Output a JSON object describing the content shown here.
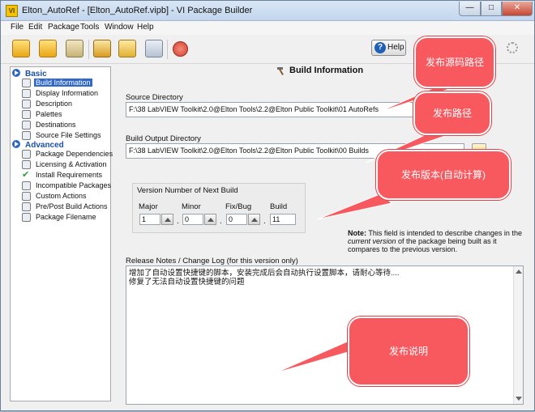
{
  "window": {
    "app_icon": "VI",
    "title": "Elton_AutoRef - [Elton_AutoRef.vipb] - VI Package Builder",
    "minimize": "—",
    "maximize": "□",
    "close": "✕"
  },
  "menu": [
    "File",
    "Edit",
    "Package",
    "Tools",
    "Window",
    "Help"
  ],
  "toolbar": {
    "buttons": [
      "new-package-icon",
      "open-package-icon",
      "save-package-icon",
      "build-icon",
      "test-icon",
      "publish-icon",
      "stop-icon"
    ],
    "help_label": "Help",
    "help_symbol": "?"
  },
  "sidebar": {
    "basic_heading": "Basic",
    "basic_items": [
      "Build Information",
      "Display Information",
      "Description",
      "Palettes",
      "Destinations",
      "Source File Settings"
    ],
    "advanced_heading": "Advanced",
    "advanced_items": [
      "Package Dependencies",
      "Licensing & Activation",
      "Install Requirements",
      "Incompatible Packages",
      "Custom Actions",
      "Pre/Post Build Actions",
      "Package Filename"
    ],
    "selected": "Build Information"
  },
  "build_info": {
    "title": "Build Information",
    "source_label": "Source Directory",
    "source_value": "F:\\38 LabVIEW Toolkit\\2.0@Elton Tools\\2.2@Elton Public Toolkit\\01 AutoRefs",
    "output_label": "Build Output Directory",
    "output_value": "F:\\38 LabVIEW Toolkit\\2.0@Elton Tools\\2.2@Elton Public Toolkit\\00 Builds",
    "version_title": "Version Number of Next Build",
    "version": {
      "major_label": "Major",
      "major": "1",
      "minor_label": "Minor",
      "minor": "0",
      "fix_label": "Fix/Bug",
      "fix": "0",
      "build_label": "Build",
      "build": "11",
      "separator": "."
    },
    "note_bold": "Note:",
    "note_1": " This field is intended to describe changes in the",
    "note_italic": "current version",
    "note_2": " of the package being built as it compares to the previous version.",
    "notes_label": "Release Notes / Change Log (for this version only)",
    "notes_lines": [
      "增加了自动设置快捷键的脚本，安装完成后会自动执行设置脚本，请耐心等待....",
      "修复了无法自动设置快捷键的问题"
    ]
  },
  "callouts": {
    "source": "发布源码路径",
    "output": "发布路径",
    "version": "发布版本(自动计算)",
    "notes": "发布说明"
  },
  "colors": {
    "callout": "#f7595f",
    "selection": "#3169c6",
    "heading": "#1c4fa8"
  }
}
